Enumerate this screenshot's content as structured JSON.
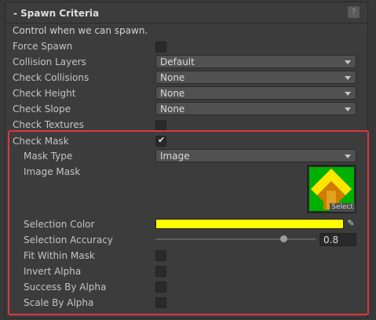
{
  "section": {
    "title": "- Spawn Criteria",
    "help_icon": "?",
    "description": "Control when we can spawn."
  },
  "rows": {
    "force_spawn": "Force Spawn",
    "collision_layers": {
      "label": "Collision Layers",
      "value": "Default"
    },
    "check_collisions": {
      "label": "Check Collisions",
      "value": "None"
    },
    "check_height": {
      "label": "Check Height",
      "value": "None"
    },
    "check_slope": {
      "label": "Check Slope",
      "value": "None"
    },
    "check_textures": "Check Textures",
    "check_mask": "Check Mask",
    "mask_type": {
      "label": "Mask Type",
      "value": "Image"
    },
    "image_mask": {
      "label": "Image Mask",
      "select_label": "Select"
    },
    "selection_color": {
      "label": "Selection Color",
      "color": "#ffff00"
    },
    "selection_accuracy": {
      "label": "Selection Accuracy",
      "value": "0.8",
      "fraction": 0.8
    },
    "fit_within_mask": "Fit Within Mask",
    "invert_alpha": "Invert Alpha",
    "success_by_alpha": "Success By Alpha",
    "scale_by_alpha": "Scale By Alpha"
  },
  "checkboxes": {
    "force_spawn": false,
    "check_textures": false,
    "check_mask": true,
    "fit_within_mask": false,
    "invert_alpha": false,
    "success_by_alpha": false,
    "scale_by_alpha": false
  },
  "icons": {
    "help": "help-icon",
    "eyedropper": "eyedropper-icon",
    "dropdown_arrow": "chevron-down-icon",
    "check": "checkmark-icon"
  },
  "colors": {
    "highlight_border": "#d9393f",
    "mask_green": "#00b000",
    "mask_yellow": "#ffe600",
    "mask_orange": "#d07a00"
  }
}
